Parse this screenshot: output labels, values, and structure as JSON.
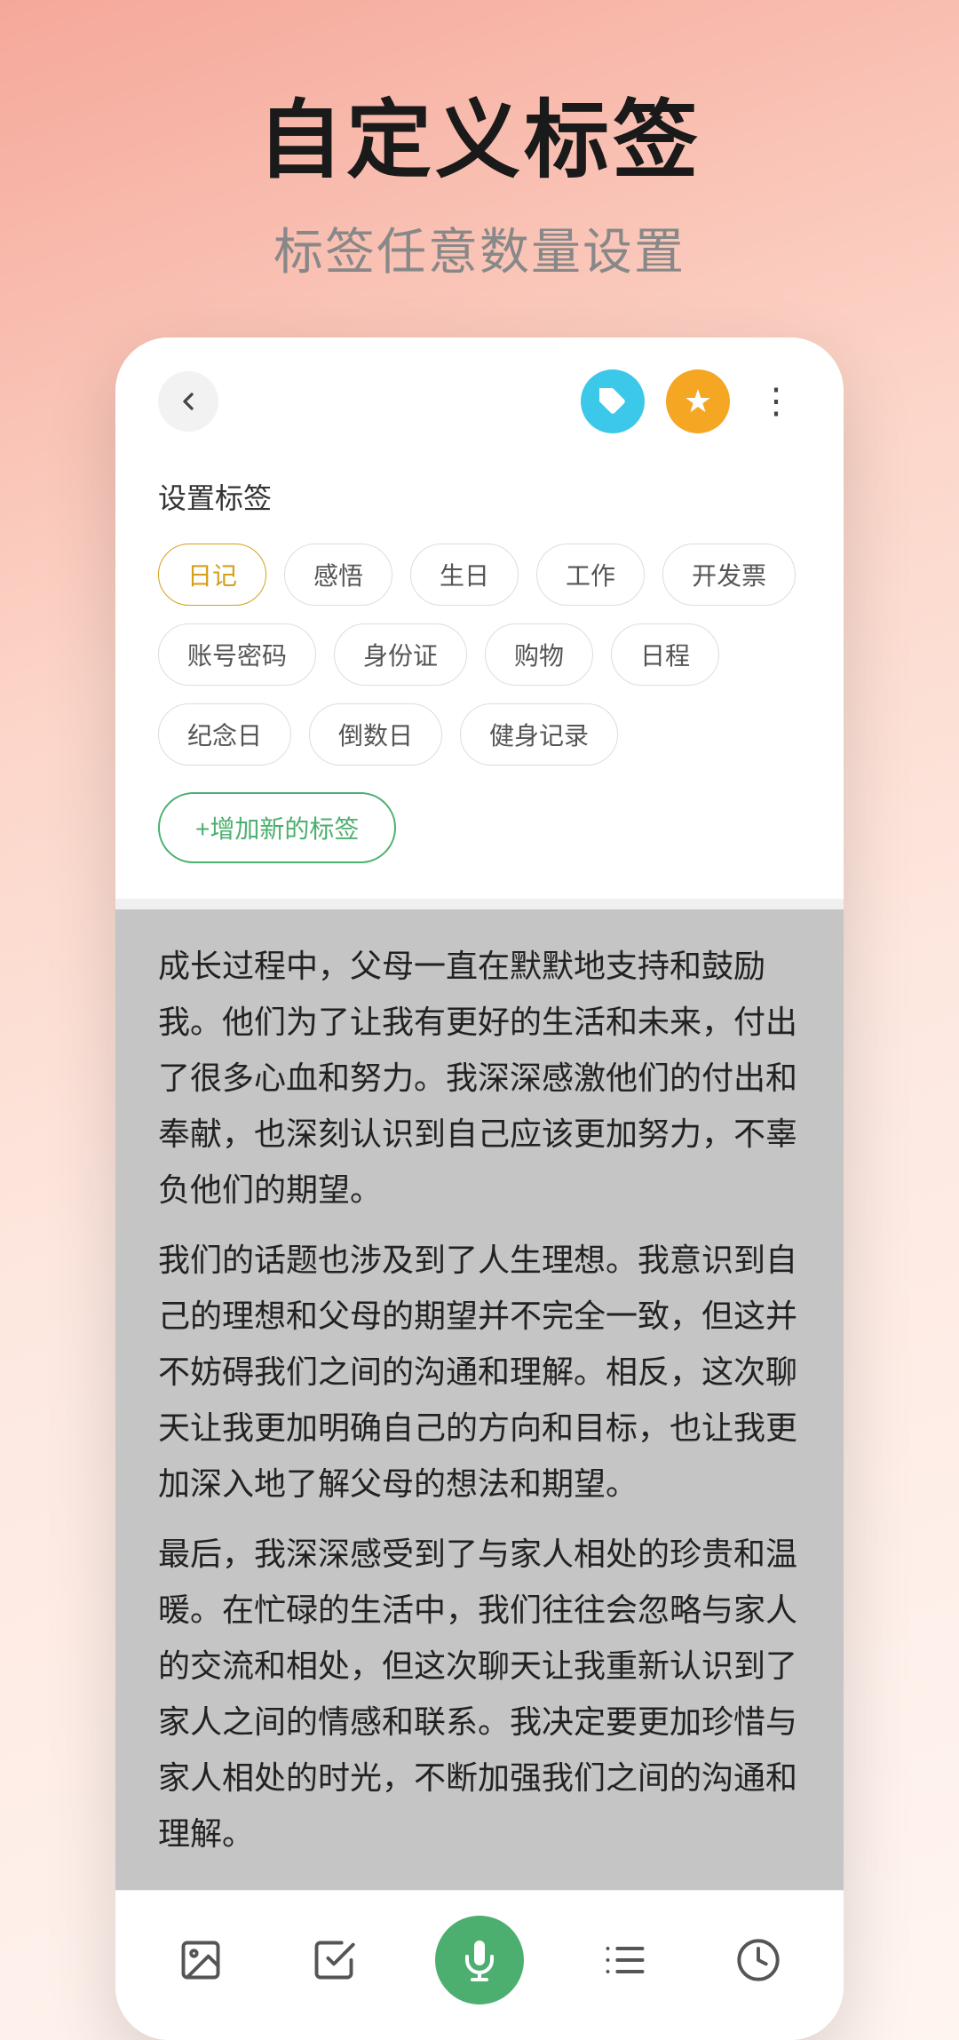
{
  "hero": {
    "title": "自定义标签",
    "subtitle": "标签任意数量设置"
  },
  "topbar": {
    "back_label": "‹"
  },
  "tags_section": {
    "title": "设置标签",
    "rows": [
      [
        "日记",
        "感悟",
        "生日",
        "工作",
        "开发票"
      ],
      [
        "账号密码",
        "身份证",
        "购物",
        "日程"
      ],
      [
        "纪念日",
        "倒数日",
        "健身记录"
      ]
    ],
    "active_tag": "日记",
    "add_button": "+增加新的标签"
  },
  "diary": {
    "content": "成长过程中，父母一直在默默地支持和鼓励我。他们为了让我有更好的生活和未来，付出了很多心血和努力。我深深感激他们的付出和奉献，也深刻认识到自己应该更加努力，不辜负他们的期望。\n我们的话题也涉及到了人生理想。我意识到自己的理想和父母的期望并不完全一致，但这并不妨碍我们之间的沟通和理解。相反，这次聊天让我更加明确自己的方向和目标，也让我更加深入地了解父母的想法和期望。\n最后，我深深感受到了与家人相处的珍贵和温暖。在忙碌的生活中，我们往往会忽略与家人的交流和相处，但这次聊天让我重新认识到了家人之间的情感和联系。我决定要更加珍惜与家人相处的时光，不断加强我们之间的沟通和理解。"
  },
  "toolbar": {
    "items": [
      "image",
      "checkbox",
      "mic",
      "list",
      "clock"
    ]
  }
}
